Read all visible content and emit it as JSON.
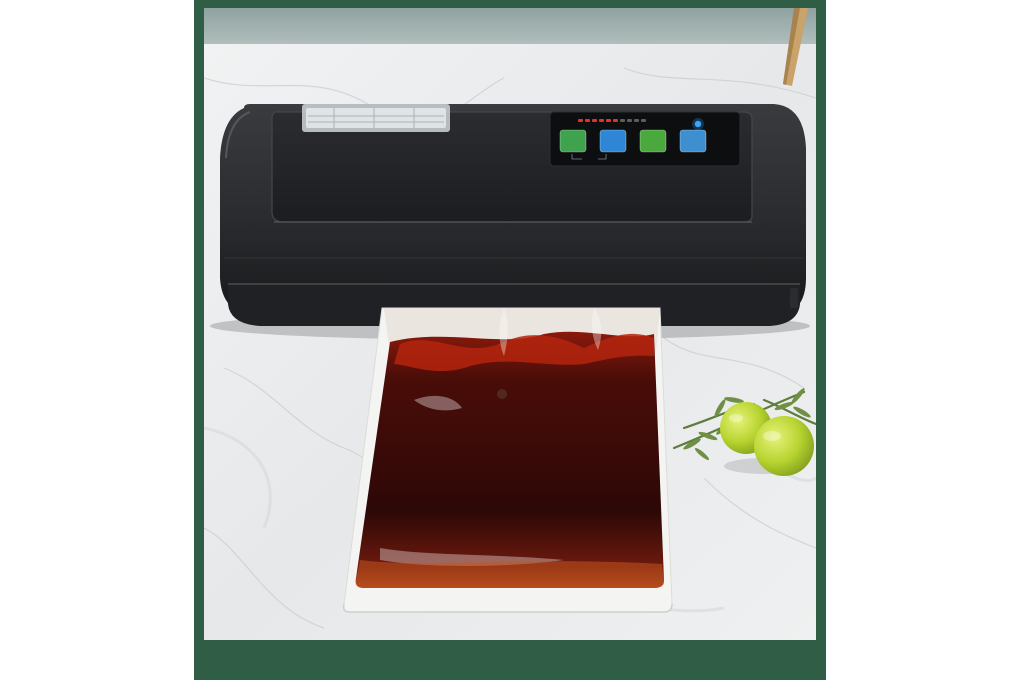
{
  "image": {
    "subject": "vacuum-sealer-with-sealed-bag",
    "colors": {
      "frame": "#2f5d45",
      "marble": "#e9ebec",
      "wall": "#9fb0ae",
      "device_body": "#2a2b2e",
      "device_lid": "#1f2023",
      "bag_liquid": "#3a0a08",
      "bag_edge": "#f4f4f2",
      "lime": "#b8d430",
      "rosemary": "#5f7d3a",
      "wood_leg": "#c9a36a"
    }
  },
  "control_panel": {
    "keys": [
      {
        "name": "seal-key",
        "label": "",
        "sublabel": "",
        "color": "#3fa34d"
      },
      {
        "name": "vac-seal-key",
        "label": "",
        "sublabel": "",
        "color": "#2f86d6"
      },
      {
        "name": "dry-moist-key",
        "label": "",
        "sublabel": "",
        "color": "#4aa83c"
      },
      {
        "name": "stop-key",
        "label": "",
        "sublabel": "",
        "color": "#3d8fd0"
      }
    ],
    "indicator_color": "#39a8ff",
    "indicator_lights_active": 6,
    "indicator_lights_total": 10
  }
}
